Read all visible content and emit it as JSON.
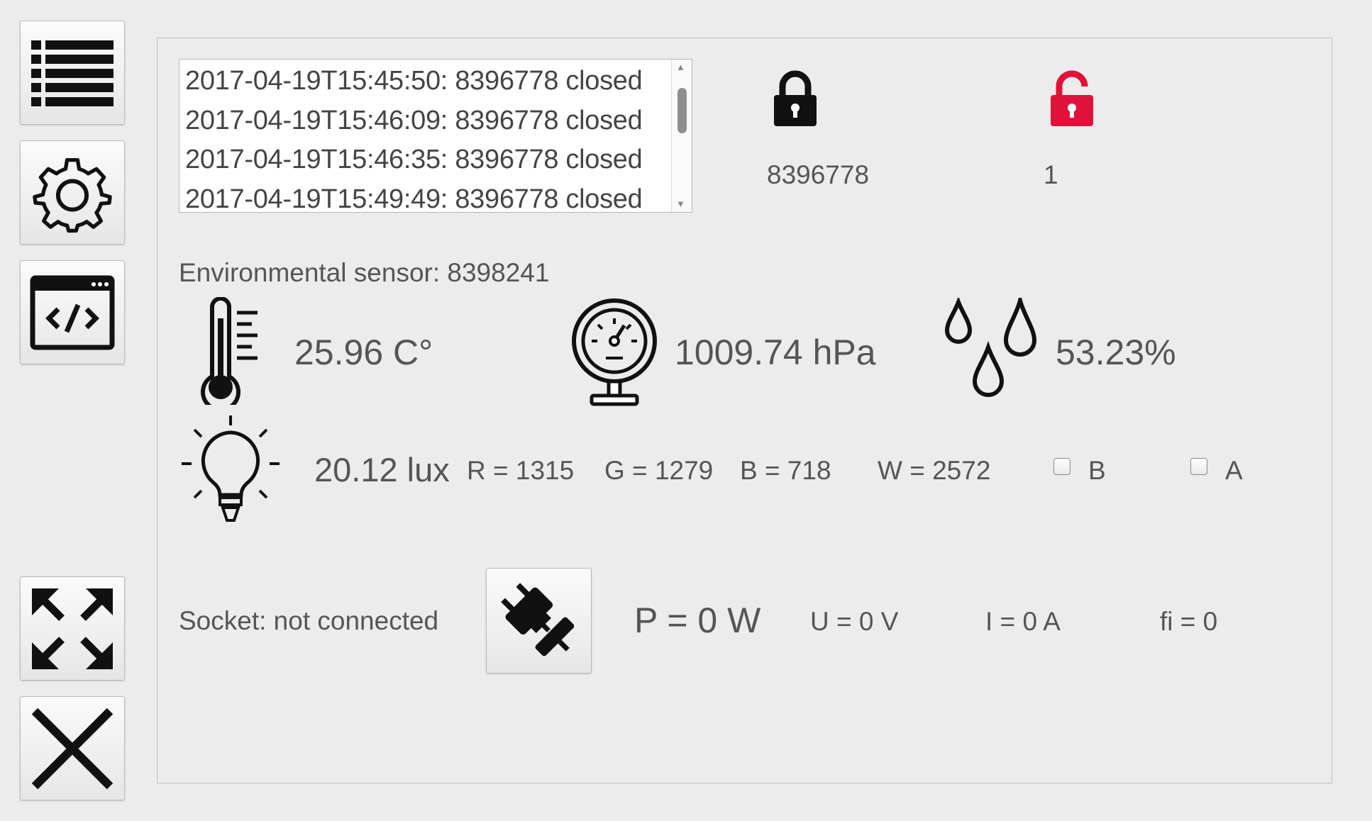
{
  "sidebar": {
    "buttons": [
      "list-view",
      "settings",
      "source-code",
      "fullscreen",
      "close"
    ]
  },
  "log": {
    "entries": [
      "2017-04-19T15:45:50: 8396778 closed",
      "2017-04-19T15:46:09: 8396778 closed",
      "2017-04-19T15:46:35: 8396778 closed",
      "2017-04-19T15:49:49: 8396778 closed"
    ]
  },
  "locks": {
    "closed_icon": "lock-closed-icon",
    "closed_value": "8396778",
    "open_icon": "lock-open-icon",
    "open_value": "1",
    "open_color": "#e0123b"
  },
  "environment": {
    "title": "Environmental sensor: 8398241",
    "temperature": "25.96 C°",
    "pressure": "1009.74 hPa",
    "humidity": "53.23%",
    "light": "20.12 lux",
    "r": "R = 1315",
    "g": "G = 1279",
    "b": "B = 718",
    "w": "W = 2572",
    "checkbox_b": "B",
    "checkbox_a": "A"
  },
  "socket": {
    "status": "Socket: not connected",
    "power": "P = 0 W",
    "voltage": "U = 0 V",
    "current": "I = 0 A",
    "phase": "fi = 0"
  }
}
